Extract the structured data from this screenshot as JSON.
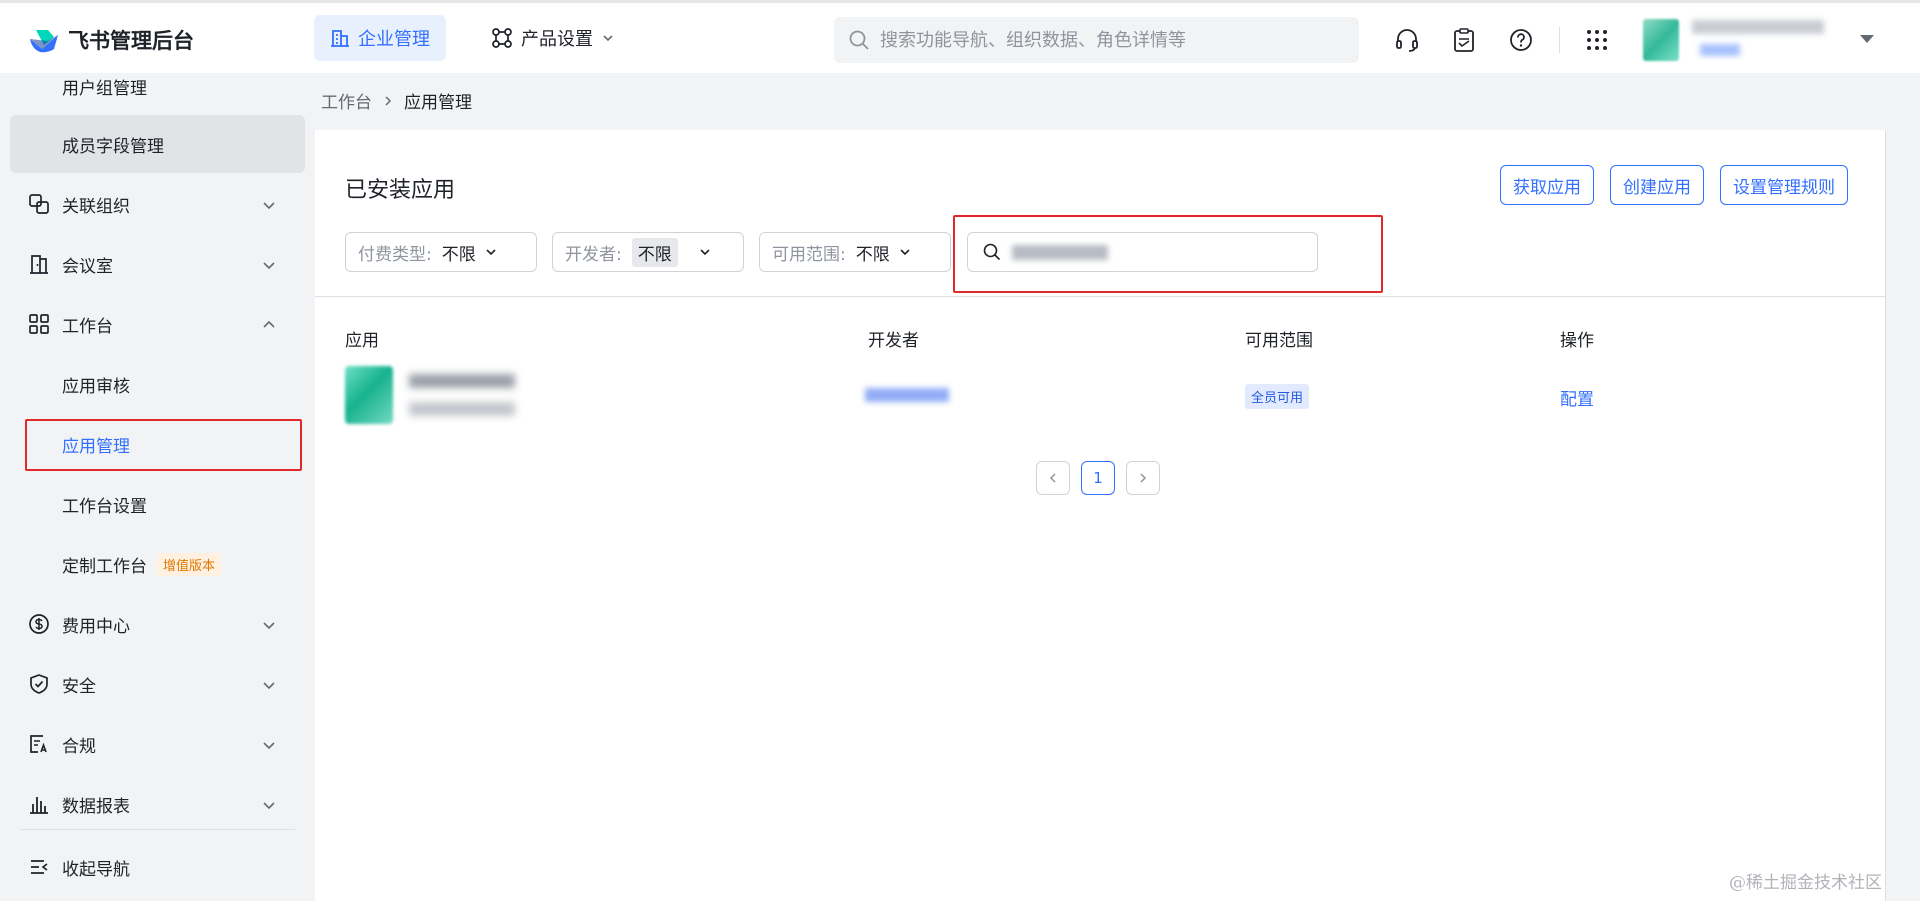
{
  "app": {
    "title": "飞书管理后台"
  },
  "topnav": {
    "tabs": [
      {
        "label": "企业管理",
        "icon": "building-icon",
        "active": true
      },
      {
        "label": "产品设置",
        "icon": "product-icon",
        "active": false
      }
    ],
    "search_placeholder": "搜索功能导航、组织数据、角色详情等",
    "icons": [
      "headset-icon",
      "clipboard-icon",
      "help-icon",
      "apps-grid-icon"
    ]
  },
  "sidebar": {
    "items": [
      {
        "label": "用户组管理",
        "type": "sub"
      },
      {
        "label": "成员字段管理",
        "type": "sub"
      },
      {
        "label": "关联组织",
        "type": "group",
        "icon": "link-org-icon"
      },
      {
        "label": "会议室",
        "type": "group",
        "icon": "meeting-room-icon"
      },
      {
        "label": "工作台",
        "type": "group",
        "icon": "workspace-icon",
        "expanded": true
      },
      {
        "label": "应用审核",
        "type": "sub"
      },
      {
        "label": "应用管理",
        "type": "sub",
        "active": true
      },
      {
        "label": "工作台设置",
        "type": "sub"
      },
      {
        "label": "定制工作台",
        "type": "sub",
        "badge": "增值版本"
      },
      {
        "label": "费用中心",
        "type": "group",
        "icon": "billing-icon"
      },
      {
        "label": "安全",
        "type": "group",
        "icon": "shield-icon"
      },
      {
        "label": "合规",
        "type": "group",
        "icon": "compliance-icon"
      },
      {
        "label": "数据报表",
        "type": "group",
        "icon": "chart-icon"
      }
    ],
    "collapse_label": "收起导航"
  },
  "breadcrumb": {
    "root": "工作台",
    "current": "应用管理"
  },
  "main": {
    "title": "已安装应用",
    "buttons": [
      "获取应用",
      "创建应用",
      "设置管理规则"
    ],
    "filters": [
      {
        "label": "付费类型:",
        "value": "不限"
      },
      {
        "label": "开发者:",
        "value": "不限"
      },
      {
        "label": "可用范围:",
        "value": "不限"
      }
    ],
    "table": {
      "columns": [
        "应用",
        "开发者",
        "可用范围",
        "操作"
      ],
      "rows": [
        {
          "scope": "全员可用",
          "action": "配置"
        }
      ]
    },
    "pagination": {
      "current": "1"
    }
  },
  "watermark": "@稀土掘金技术社区",
  "colors": {
    "accent": "#3370ff",
    "highlight": "#e0292b"
  }
}
